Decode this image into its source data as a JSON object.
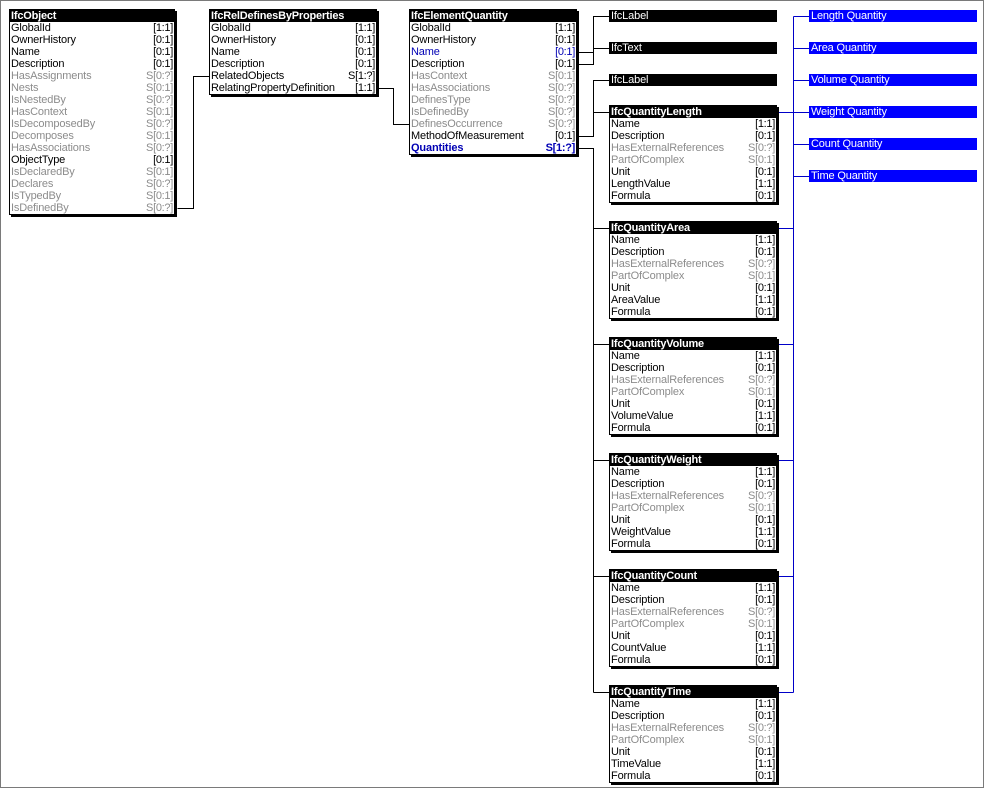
{
  "entities": {
    "ifcobject": {
      "title": "IfcObject",
      "attrs": [
        {
          "name": "GlobalId",
          "card": "[1:1]",
          "kind": "direct"
        },
        {
          "name": "OwnerHistory",
          "card": "[0:1]",
          "kind": "direct"
        },
        {
          "name": "Name",
          "card": "[0:1]",
          "kind": "direct"
        },
        {
          "name": "Description",
          "card": "[0:1]",
          "kind": "direct"
        },
        {
          "name": "HasAssignments",
          "card": "S[0:?]",
          "kind": "inverse"
        },
        {
          "name": "Nests",
          "card": "S[0:1]",
          "kind": "inverse"
        },
        {
          "name": "IsNestedBy",
          "card": "S[0:?]",
          "kind": "inverse"
        },
        {
          "name": "HasContext",
          "card": "S[0:1]",
          "kind": "inverse"
        },
        {
          "name": "IsDecomposedBy",
          "card": "S[0:?]",
          "kind": "inverse"
        },
        {
          "name": "Decomposes",
          "card": "S[0:1]",
          "kind": "inverse"
        },
        {
          "name": "HasAssociations",
          "card": "S[0:?]",
          "kind": "inverse"
        },
        {
          "name": "ObjectType",
          "card": "[0:1]",
          "kind": "direct"
        },
        {
          "name": "IsDeclaredBy",
          "card": "S[0:1]",
          "kind": "inverse"
        },
        {
          "name": "Declares",
          "card": "S[0:?]",
          "kind": "inverse"
        },
        {
          "name": "IsTypedBy",
          "card": "S[0:1]",
          "kind": "inverse"
        },
        {
          "name": "IsDefinedBy",
          "card": "S[0:?]",
          "kind": "inverse"
        }
      ]
    },
    "ifcreldefinesbyproperties": {
      "title": "IfcRelDefinesByProperties",
      "attrs": [
        {
          "name": "GlobalId",
          "card": "[1:1]",
          "kind": "direct"
        },
        {
          "name": "OwnerHistory",
          "card": "[0:1]",
          "kind": "direct"
        },
        {
          "name": "Name",
          "card": "[0:1]",
          "kind": "direct"
        },
        {
          "name": "Description",
          "card": "[0:1]",
          "kind": "direct"
        },
        {
          "name": "RelatedObjects",
          "card": "S[1:?]",
          "kind": "direct"
        },
        {
          "name": "RelatingPropertyDefinition",
          "card": "[1:1]",
          "kind": "direct"
        }
      ]
    },
    "ifcelementquantity": {
      "title": "IfcElementQuantity",
      "attrs": [
        {
          "name": "GlobalId",
          "card": "[1:1]",
          "kind": "direct"
        },
        {
          "name": "OwnerHistory",
          "card": "[0:1]",
          "kind": "direct"
        },
        {
          "name": "Name",
          "card": "[0:1]",
          "kind": "selected"
        },
        {
          "name": "Description",
          "card": "[0:1]",
          "kind": "direct"
        },
        {
          "name": "HasContext",
          "card": "S[0:1]",
          "kind": "inverse"
        },
        {
          "name": "HasAssociations",
          "card": "S[0:?]",
          "kind": "inverse"
        },
        {
          "name": "DefinesType",
          "card": "S[0:?]",
          "kind": "inverse"
        },
        {
          "name": "IsDefinedBy",
          "card": "S[0:?]",
          "kind": "inverse"
        },
        {
          "name": "DefinesOccurrence",
          "card": "S[0:?]",
          "kind": "inverse"
        },
        {
          "name": "MethodOfMeasurement",
          "card": "[0:1]",
          "kind": "direct"
        },
        {
          "name": "Quantities",
          "card": "S[1:?]",
          "kind": "selected-bold"
        }
      ]
    },
    "ifcquantitylength": {
      "title": "IfcQuantityLength",
      "attrs": [
        {
          "name": "Name",
          "card": "[1:1]",
          "kind": "direct"
        },
        {
          "name": "Description",
          "card": "[0:1]",
          "kind": "direct"
        },
        {
          "name": "HasExternalReferences",
          "card": "S[0:?]",
          "kind": "inverse"
        },
        {
          "name": "PartOfComplex",
          "card": "S[0:1]",
          "kind": "inverse"
        },
        {
          "name": "Unit",
          "card": "[0:1]",
          "kind": "direct"
        },
        {
          "name": "LengthValue",
          "card": "[1:1]",
          "kind": "direct"
        },
        {
          "name": "Formula",
          "card": "[0:1]",
          "kind": "direct"
        }
      ]
    },
    "ifcquantityarea": {
      "title": "IfcQuantityArea",
      "attrs": [
        {
          "name": "Name",
          "card": "[1:1]",
          "kind": "direct"
        },
        {
          "name": "Description",
          "card": "[0:1]",
          "kind": "direct"
        },
        {
          "name": "HasExternalReferences",
          "card": "S[0:?]",
          "kind": "inverse"
        },
        {
          "name": "PartOfComplex",
          "card": "S[0:1]",
          "kind": "inverse"
        },
        {
          "name": "Unit",
          "card": "[0:1]",
          "kind": "direct"
        },
        {
          "name": "AreaValue",
          "card": "[1:1]",
          "kind": "direct"
        },
        {
          "name": "Formula",
          "card": "[0:1]",
          "kind": "direct"
        }
      ]
    },
    "ifcquantityvolume": {
      "title": "IfcQuantityVolume",
      "attrs": [
        {
          "name": "Name",
          "card": "[1:1]",
          "kind": "direct"
        },
        {
          "name": "Description",
          "card": "[0:1]",
          "kind": "direct"
        },
        {
          "name": "HasExternalReferences",
          "card": "S[0:?]",
          "kind": "inverse"
        },
        {
          "name": "PartOfComplex",
          "card": "S[0:1]",
          "kind": "inverse"
        },
        {
          "name": "Unit",
          "card": "[0:1]",
          "kind": "direct"
        },
        {
          "name": "VolumeValue",
          "card": "[1:1]",
          "kind": "direct"
        },
        {
          "name": "Formula",
          "card": "[0:1]",
          "kind": "direct"
        }
      ]
    },
    "ifcquantityweight": {
      "title": "IfcQuantityWeight",
      "attrs": [
        {
          "name": "Name",
          "card": "[1:1]",
          "kind": "direct"
        },
        {
          "name": "Description",
          "card": "[0:1]",
          "kind": "direct"
        },
        {
          "name": "HasExternalReferences",
          "card": "S[0:?]",
          "kind": "inverse"
        },
        {
          "name": "PartOfComplex",
          "card": "S[0:1]",
          "kind": "inverse"
        },
        {
          "name": "Unit",
          "card": "[0:1]",
          "kind": "direct"
        },
        {
          "name": "WeightValue",
          "card": "[1:1]",
          "kind": "direct"
        },
        {
          "name": "Formula",
          "card": "[0:1]",
          "kind": "direct"
        }
      ]
    },
    "ifcquantitycount": {
      "title": "IfcQuantityCount",
      "attrs": [
        {
          "name": "Name",
          "card": "[1:1]",
          "kind": "direct"
        },
        {
          "name": "Description",
          "card": "[0:1]",
          "kind": "direct"
        },
        {
          "name": "HasExternalReferences",
          "card": "S[0:?]",
          "kind": "inverse"
        },
        {
          "name": "PartOfComplex",
          "card": "S[0:1]",
          "kind": "inverse"
        },
        {
          "name": "Unit",
          "card": "[0:1]",
          "kind": "direct"
        },
        {
          "name": "CountValue",
          "card": "[1:1]",
          "kind": "direct"
        },
        {
          "name": "Formula",
          "card": "[0:1]",
          "kind": "direct"
        }
      ]
    },
    "ifcquantitytime": {
      "title": "IfcQuantityTime",
      "attrs": [
        {
          "name": "Name",
          "card": "[1:1]",
          "kind": "direct"
        },
        {
          "name": "Description",
          "card": "[0:1]",
          "kind": "direct"
        },
        {
          "name": "HasExternalReferences",
          "card": "S[0:?]",
          "kind": "inverse"
        },
        {
          "name": "PartOfComplex",
          "card": "S[0:1]",
          "kind": "inverse"
        },
        {
          "name": "Unit",
          "card": "[0:1]",
          "kind": "direct"
        },
        {
          "name": "TimeValue",
          "card": "[1:1]",
          "kind": "direct"
        },
        {
          "name": "Formula",
          "card": "[0:1]",
          "kind": "direct"
        }
      ]
    }
  },
  "types": {
    "label_name": "IfcLabel",
    "text_description": "IfcText",
    "label_method": "IfcLabel"
  },
  "enums": {
    "length": "Length Quantity",
    "area": "Area Quantity",
    "volume": "Volume Quantity",
    "weight": "Weight Quantity",
    "count": "Count Quantity",
    "time": "Time Quantity"
  },
  "colors": {
    "header": "#000000",
    "inverse_text": "#8c8c8c",
    "selected_text": "#0000b4",
    "connector": "#000000",
    "enum_fill": "#0000ff",
    "enum_connector": "#0000c8"
  }
}
